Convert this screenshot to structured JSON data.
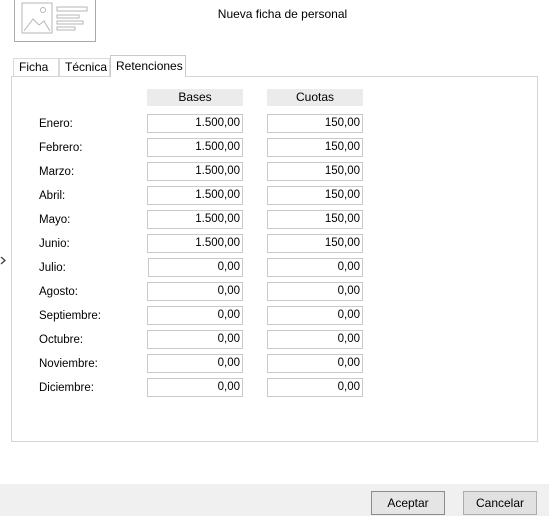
{
  "header": {
    "title": "Nueva ficha de personal"
  },
  "tabs": [
    {
      "label": "Ficha"
    },
    {
      "label": "Técnica"
    },
    {
      "label": "Retenciones"
    }
  ],
  "columns": {
    "bases": "Bases",
    "cuotas": "Cuotas"
  },
  "rows": [
    {
      "label": "Enero:",
      "base": "1.500,00",
      "cuota": "150,00"
    },
    {
      "label": "Febrero:",
      "base": "1.500,00",
      "cuota": "150,00"
    },
    {
      "label": "Marzo:",
      "base": "1.500,00",
      "cuota": "150,00"
    },
    {
      "label": "Abril:",
      "base": "1.500,00",
      "cuota": "150,00"
    },
    {
      "label": "Mayo:",
      "base": "1.500,00",
      "cuota": "150,00"
    },
    {
      "label": "Junio:",
      "base": "1.500,00",
      "cuota": "150,00"
    },
    {
      "label": "Julio:",
      "base": "0,00",
      "cuota": "0,00"
    },
    {
      "label": "Agosto:",
      "base": "0,00",
      "cuota": "0,00"
    },
    {
      "label": "Septiembre:",
      "base": "0,00",
      "cuota": "0,00"
    },
    {
      "label": "Octubre:",
      "base": "0,00",
      "cuota": "0,00"
    },
    {
      "label": "Noviembre:",
      "base": "0,00",
      "cuota": "0,00"
    },
    {
      "label": "Diciembre:",
      "base": "0,00",
      "cuota": "0,00"
    }
  ],
  "buttons": {
    "accept": "Aceptar",
    "cancel": "Cancelar"
  },
  "icons": {
    "header": "image-placeholder-icon",
    "side": "chevron-right-icon"
  }
}
